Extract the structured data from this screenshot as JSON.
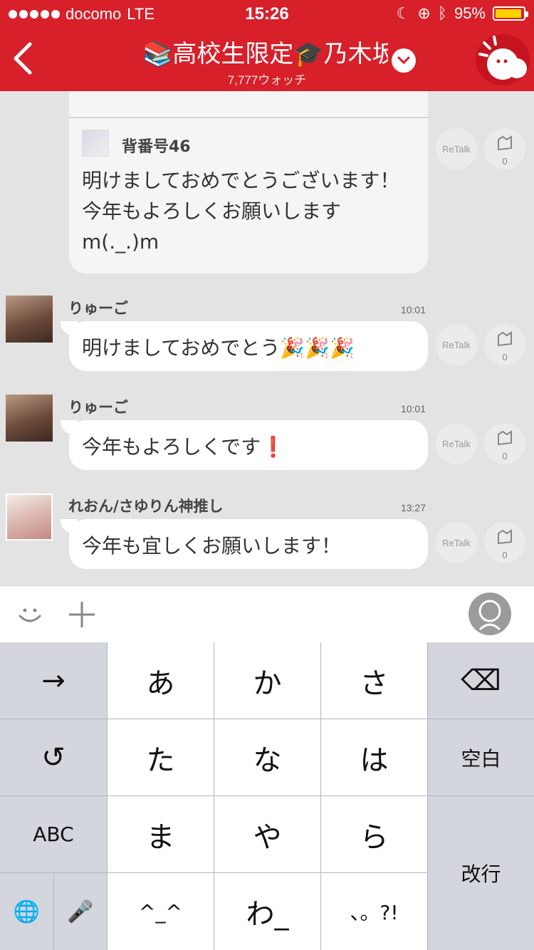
{
  "status": {
    "carrier": "docomo",
    "network": "LTE",
    "time": "15:26",
    "battery": "95%",
    "battery_level": 0.95
  },
  "header": {
    "title": "📚高校生限定🎓乃木坂",
    "subtitle": "7,777ウォッチ"
  },
  "chat": {
    "top_card": {
      "name": "背番号46",
      "text": "明けましておめでとうございます！今年もよろしくお願いします m(._.)m"
    },
    "retalk_label": "ReTalk",
    "messages": [
      {
        "name": "りゅーご",
        "time": "10:01",
        "text": "明けましておめでとう🎉🎉🎉",
        "clap_count": "0"
      },
      {
        "name": "りゅーご",
        "time": "10:01",
        "text": "今年もよろしくです❗",
        "clap_count": "0"
      },
      {
        "name": "れおん/さゆりん神推し",
        "time": "13:27",
        "text": "今年も宜しくお願いします！",
        "clap_count": "0"
      }
    ],
    "top_clap_count": "0"
  },
  "keyboard": {
    "row1": [
      "→",
      "あ",
      "か",
      "さ",
      "⌫"
    ],
    "row2": [
      "↺",
      "た",
      "な",
      "は",
      "空白"
    ],
    "row3": [
      "ABC",
      "ま",
      "や",
      "ら",
      "改行"
    ],
    "row4": [
      "🌐",
      "🎤",
      "^_^",
      "わ_",
      "、。?!"
    ]
  },
  "colors": {
    "brand_red": "#d7202a",
    "battery": "#ffd200"
  }
}
